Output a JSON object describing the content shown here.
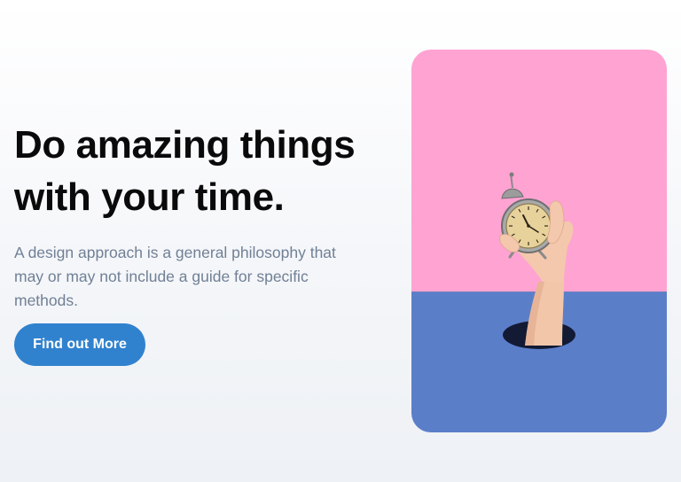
{
  "hero": {
    "headline_line1": "Do amazing things",
    "headline_line2": "with your time.",
    "description": "A design approach is a general philosophy that may or may not include a guide for specific methods.",
    "cta_label": "Find out More"
  },
  "image": {
    "subject": "hand-holding-alarm-clock",
    "colors": {
      "top": "#ffa3d2",
      "bottom": "#5b7ec9",
      "button": "#3182ce"
    }
  }
}
